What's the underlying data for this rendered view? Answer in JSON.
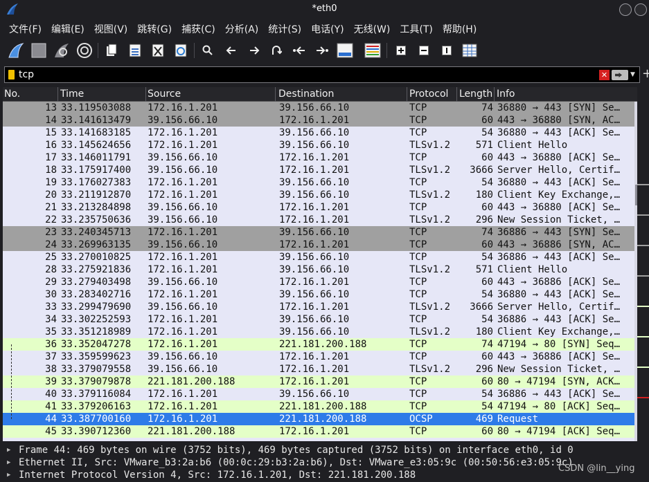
{
  "window": {
    "title": "*eth0"
  },
  "menu": [
    "文件(F)",
    "编辑(E)",
    "视图(V)",
    "跳转(G)",
    "捕获(C)",
    "分析(A)",
    "统计(S)",
    "电话(Y)",
    "无线(W)",
    "工具(T)",
    "帮助(H)"
  ],
  "toolbar": {
    "icons": [
      "shark-fin-start-icon",
      "stop-square-icon",
      "restart-fin-icon",
      "options-gear-icon",
      "open-file-icon",
      "save-file-icon",
      "close-file-icon",
      "reload-file-icon",
      "find-icon",
      "back-arrow-icon",
      "forward-arrow-icon",
      "goto-packet-icon",
      "first-packet-icon",
      "last-packet-icon",
      "autoscroll-icon",
      "colorize-icon",
      "zoom-in-icon",
      "zoom-out-icon",
      "normal-size-icon",
      "resize-columns-icon"
    ]
  },
  "filter": {
    "value": "tcp"
  },
  "columns": [
    "No.",
    "Time",
    "Source",
    "Destination",
    "Protocol",
    "Length",
    "Info"
  ],
  "colors": {
    "gray": "#a0a0a0",
    "lavender": "#e6e7f7",
    "green": "#e4ffc7",
    "selected": "#2e7be8"
  },
  "packets": [
    {
      "no": "13",
      "time": "33.119503088",
      "src": "172.16.1.201",
      "dst": "39.156.66.10",
      "proto": "TCP",
      "len": "74",
      "info": "36880 → 443 [SYN] Se…",
      "color": "gray"
    },
    {
      "no": "14",
      "time": "33.141613479",
      "src": "39.156.66.10",
      "dst": "172.16.1.201",
      "proto": "TCP",
      "len": "60",
      "info": "443 → 36880 [SYN, AC…",
      "color": "gray"
    },
    {
      "no": "15",
      "time": "33.141683185",
      "src": "172.16.1.201",
      "dst": "39.156.66.10",
      "proto": "TCP",
      "len": "54",
      "info": "36880 → 443 [ACK] Se…",
      "color": "lavender"
    },
    {
      "no": "16",
      "time": "33.145624656",
      "src": "172.16.1.201",
      "dst": "39.156.66.10",
      "proto": "TLSv1.2",
      "len": "571",
      "info": "Client Hello",
      "color": "lavender"
    },
    {
      "no": "17",
      "time": "33.146011791",
      "src": "39.156.66.10",
      "dst": "172.16.1.201",
      "proto": "TCP",
      "len": "60",
      "info": "443 → 36880 [ACK] Se…",
      "color": "lavender"
    },
    {
      "no": "18",
      "time": "33.175917400",
      "src": "39.156.66.10",
      "dst": "172.16.1.201",
      "proto": "TLSv1.2",
      "len": "3666",
      "info": "Server Hello, Certif…",
      "color": "lavender"
    },
    {
      "no": "19",
      "time": "33.176027383",
      "src": "172.16.1.201",
      "dst": "39.156.66.10",
      "proto": "TCP",
      "len": "54",
      "info": "36880 → 443 [ACK] Se…",
      "color": "lavender"
    },
    {
      "no": "20",
      "time": "33.211912870",
      "src": "172.16.1.201",
      "dst": "39.156.66.10",
      "proto": "TLSv1.2",
      "len": "180",
      "info": "Client Key Exchange,…",
      "color": "lavender"
    },
    {
      "no": "21",
      "time": "33.213284898",
      "src": "39.156.66.10",
      "dst": "172.16.1.201",
      "proto": "TCP",
      "len": "60",
      "info": "443 → 36880 [ACK] Se…",
      "color": "lavender"
    },
    {
      "no": "22",
      "time": "33.235750636",
      "src": "39.156.66.10",
      "dst": "172.16.1.201",
      "proto": "TLSv1.2",
      "len": "296",
      "info": "New Session Ticket, …",
      "color": "lavender"
    },
    {
      "no": "23",
      "time": "33.240345713",
      "src": "172.16.1.201",
      "dst": "39.156.66.10",
      "proto": "TCP",
      "len": "74",
      "info": "36886 → 443 [SYN] Se…",
      "color": "gray"
    },
    {
      "no": "24",
      "time": "33.269963135",
      "src": "39.156.66.10",
      "dst": "172.16.1.201",
      "proto": "TCP",
      "len": "60",
      "info": "443 → 36886 [SYN, AC…",
      "color": "gray"
    },
    {
      "no": "25",
      "time": "33.270010825",
      "src": "172.16.1.201",
      "dst": "39.156.66.10",
      "proto": "TCP",
      "len": "54",
      "info": "36886 → 443 [ACK] Se…",
      "color": "lavender"
    },
    {
      "no": "28",
      "time": "33.275921836",
      "src": "172.16.1.201",
      "dst": "39.156.66.10",
      "proto": "TLSv1.2",
      "len": "571",
      "info": "Client Hello",
      "color": "lavender"
    },
    {
      "no": "29",
      "time": "33.279403498",
      "src": "39.156.66.10",
      "dst": "172.16.1.201",
      "proto": "TCP",
      "len": "60",
      "info": "443 → 36886 [ACK] Se…",
      "color": "lavender"
    },
    {
      "no": "30",
      "time": "33.283402716",
      "src": "172.16.1.201",
      "dst": "39.156.66.10",
      "proto": "TCP",
      "len": "54",
      "info": "36880 → 443 [ACK] Se…",
      "color": "lavender"
    },
    {
      "no": "33",
      "time": "33.299479690",
      "src": "39.156.66.10",
      "dst": "172.16.1.201",
      "proto": "TLSv1.2",
      "len": "3666",
      "info": "Server Hello, Certif…",
      "color": "lavender"
    },
    {
      "no": "34",
      "time": "33.302252593",
      "src": "172.16.1.201",
      "dst": "39.156.66.10",
      "proto": "TCP",
      "len": "54",
      "info": "36886 → 443 [ACK] Se…",
      "color": "lavender"
    },
    {
      "no": "35",
      "time": "33.351218989",
      "src": "172.16.1.201",
      "dst": "39.156.66.10",
      "proto": "TLSv1.2",
      "len": "180",
      "info": "Client Key Exchange,…",
      "color": "lavender"
    },
    {
      "no": "36",
      "time": "33.352047278",
      "src": "172.16.1.201",
      "dst": "221.181.200.188",
      "proto": "TCP",
      "len": "74",
      "info": "47194 → 80 [SYN] Seq…",
      "color": "green"
    },
    {
      "no": "37",
      "time": "33.359599623",
      "src": "39.156.66.10",
      "dst": "172.16.1.201",
      "proto": "TCP",
      "len": "60",
      "info": "443 → 36886 [ACK] Se…",
      "color": "lavender"
    },
    {
      "no": "38",
      "time": "33.379079558",
      "src": "39.156.66.10",
      "dst": "172.16.1.201",
      "proto": "TLSv1.2",
      "len": "296",
      "info": "New Session Ticket, …",
      "color": "lavender"
    },
    {
      "no": "39",
      "time": "33.379079878",
      "src": "221.181.200.188",
      "dst": "172.16.1.201",
      "proto": "TCP",
      "len": "60",
      "info": "80 → 47194 [SYN, ACK…",
      "color": "green"
    },
    {
      "no": "40",
      "time": "33.379116084",
      "src": "172.16.1.201",
      "dst": "39.156.66.10",
      "proto": "TCP",
      "len": "54",
      "info": "36886 → 443 [ACK] Se…",
      "color": "lavender"
    },
    {
      "no": "41",
      "time": "33.379206163",
      "src": "172.16.1.201",
      "dst": "221.181.200.188",
      "proto": "TCP",
      "len": "54",
      "info": "47194 → 80 [ACK] Seq…",
      "color": "green"
    },
    {
      "no": "44",
      "time": "33.387700160",
      "src": "172.16.1.201",
      "dst": "221.181.200.188",
      "proto": "OCSP",
      "len": "469",
      "info": "Request",
      "color": "selected"
    },
    {
      "no": "45",
      "time": "33.390712360",
      "src": "221.181.200.188",
      "dst": "172.16.1.201",
      "proto": "TCP",
      "len": "60",
      "info": "80 → 47194 [ACK] Seq…",
      "color": "green"
    }
  ],
  "details": [
    "Frame 44: 469 bytes on wire (3752 bits), 469 bytes captured (3752 bits) on interface eth0, id 0",
    "Ethernet II, Src: VMware_b3:2a:b6 (00:0c:29:b3:2a:b6), Dst: VMware_e3:05:9c (00:50:56:e3:05:9c)",
    "Internet Protocol Version 4, Src: 172.16.1.201, Dst: 221.181.200.188"
  ],
  "watermark": "CSDN @lin__ying"
}
